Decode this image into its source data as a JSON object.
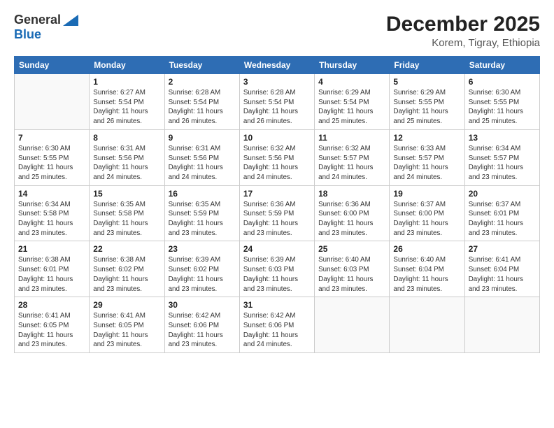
{
  "logo": {
    "general": "General",
    "blue": "Blue"
  },
  "title": {
    "main": "December 2025",
    "sub": "Korem, Tigray, Ethiopia"
  },
  "days": [
    "Sunday",
    "Monday",
    "Tuesday",
    "Wednesday",
    "Thursday",
    "Friday",
    "Saturday"
  ],
  "weeks": [
    [
      {
        "date": "",
        "sunrise": "",
        "sunset": "",
        "daylight": ""
      },
      {
        "date": "1",
        "sunrise": "6:27 AM",
        "sunset": "5:54 PM",
        "daylight": "11 hours and 26 minutes."
      },
      {
        "date": "2",
        "sunrise": "6:28 AM",
        "sunset": "5:54 PM",
        "daylight": "11 hours and 26 minutes."
      },
      {
        "date": "3",
        "sunrise": "6:28 AM",
        "sunset": "5:54 PM",
        "daylight": "11 hours and 26 minutes."
      },
      {
        "date": "4",
        "sunrise": "6:29 AM",
        "sunset": "5:54 PM",
        "daylight": "11 hours and 25 minutes."
      },
      {
        "date": "5",
        "sunrise": "6:29 AM",
        "sunset": "5:55 PM",
        "daylight": "11 hours and 25 minutes."
      },
      {
        "date": "6",
        "sunrise": "6:30 AM",
        "sunset": "5:55 PM",
        "daylight": "11 hours and 25 minutes."
      }
    ],
    [
      {
        "date": "7",
        "sunrise": "6:30 AM",
        "sunset": "5:55 PM",
        "daylight": "11 hours and 25 minutes."
      },
      {
        "date": "8",
        "sunrise": "6:31 AM",
        "sunset": "5:56 PM",
        "daylight": "11 hours and 24 minutes."
      },
      {
        "date": "9",
        "sunrise": "6:31 AM",
        "sunset": "5:56 PM",
        "daylight": "11 hours and 24 minutes."
      },
      {
        "date": "10",
        "sunrise": "6:32 AM",
        "sunset": "5:56 PM",
        "daylight": "11 hours and 24 minutes."
      },
      {
        "date": "11",
        "sunrise": "6:32 AM",
        "sunset": "5:57 PM",
        "daylight": "11 hours and 24 minutes."
      },
      {
        "date": "12",
        "sunrise": "6:33 AM",
        "sunset": "5:57 PM",
        "daylight": "11 hours and 24 minutes."
      },
      {
        "date": "13",
        "sunrise": "6:34 AM",
        "sunset": "5:57 PM",
        "daylight": "11 hours and 23 minutes."
      }
    ],
    [
      {
        "date": "14",
        "sunrise": "6:34 AM",
        "sunset": "5:58 PM",
        "daylight": "11 hours and 23 minutes."
      },
      {
        "date": "15",
        "sunrise": "6:35 AM",
        "sunset": "5:58 PM",
        "daylight": "11 hours and 23 minutes."
      },
      {
        "date": "16",
        "sunrise": "6:35 AM",
        "sunset": "5:59 PM",
        "daylight": "11 hours and 23 minutes."
      },
      {
        "date": "17",
        "sunrise": "6:36 AM",
        "sunset": "5:59 PM",
        "daylight": "11 hours and 23 minutes."
      },
      {
        "date": "18",
        "sunrise": "6:36 AM",
        "sunset": "6:00 PM",
        "daylight": "11 hours and 23 minutes."
      },
      {
        "date": "19",
        "sunrise": "6:37 AM",
        "sunset": "6:00 PM",
        "daylight": "11 hours and 23 minutes."
      },
      {
        "date": "20",
        "sunrise": "6:37 AM",
        "sunset": "6:01 PM",
        "daylight": "11 hours and 23 minutes."
      }
    ],
    [
      {
        "date": "21",
        "sunrise": "6:38 AM",
        "sunset": "6:01 PM",
        "daylight": "11 hours and 23 minutes."
      },
      {
        "date": "22",
        "sunrise": "6:38 AM",
        "sunset": "6:02 PM",
        "daylight": "11 hours and 23 minutes."
      },
      {
        "date": "23",
        "sunrise": "6:39 AM",
        "sunset": "6:02 PM",
        "daylight": "11 hours and 23 minutes."
      },
      {
        "date": "24",
        "sunrise": "6:39 AM",
        "sunset": "6:03 PM",
        "daylight": "11 hours and 23 minutes."
      },
      {
        "date": "25",
        "sunrise": "6:40 AM",
        "sunset": "6:03 PM",
        "daylight": "11 hours and 23 minutes."
      },
      {
        "date": "26",
        "sunrise": "6:40 AM",
        "sunset": "6:04 PM",
        "daylight": "11 hours and 23 minutes."
      },
      {
        "date": "27",
        "sunrise": "6:41 AM",
        "sunset": "6:04 PM",
        "daylight": "11 hours and 23 minutes."
      }
    ],
    [
      {
        "date": "28",
        "sunrise": "6:41 AM",
        "sunset": "6:05 PM",
        "daylight": "11 hours and 23 minutes."
      },
      {
        "date": "29",
        "sunrise": "6:41 AM",
        "sunset": "6:05 PM",
        "daylight": "11 hours and 23 minutes."
      },
      {
        "date": "30",
        "sunrise": "6:42 AM",
        "sunset": "6:06 PM",
        "daylight": "11 hours and 23 minutes."
      },
      {
        "date": "31",
        "sunrise": "6:42 AM",
        "sunset": "6:06 PM",
        "daylight": "11 hours and 24 minutes."
      },
      {
        "date": "",
        "sunrise": "",
        "sunset": "",
        "daylight": ""
      },
      {
        "date": "",
        "sunrise": "",
        "sunset": "",
        "daylight": ""
      },
      {
        "date": "",
        "sunrise": "",
        "sunset": "",
        "daylight": ""
      }
    ]
  ]
}
